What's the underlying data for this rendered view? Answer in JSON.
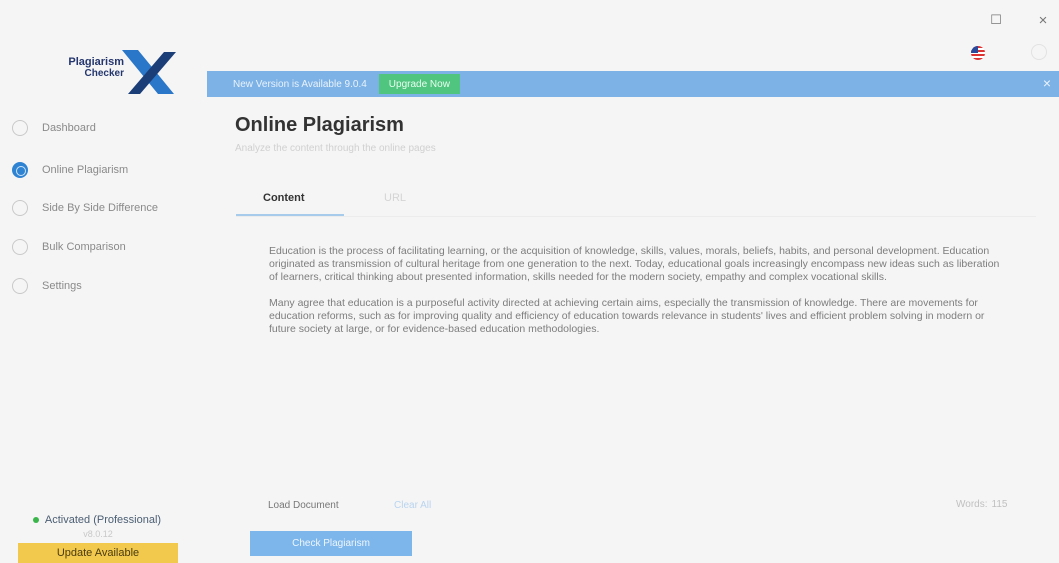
{
  "window": {
    "maximize_glyph": "☐",
    "close_glyph": "×"
  },
  "app": {
    "logo_line1": "Plagiarism",
    "logo_line2": "Checker",
    "logo_mark": "X"
  },
  "sidebar": {
    "items": [
      {
        "label": "Dashboard",
        "icon": "dashboard-icon",
        "active": false
      },
      {
        "label": "Online Plagiarism",
        "icon": "globe-icon",
        "active": true
      },
      {
        "label": "Side By Side Difference",
        "icon": "compare-icon",
        "active": false
      },
      {
        "label": "Bulk Comparison",
        "icon": "bulk-icon",
        "active": false
      },
      {
        "label": "Settings",
        "icon": "gear-icon",
        "active": false
      }
    ],
    "status": "Activated (Professional)",
    "version": "v8.0.12",
    "update_label": "Update Available"
  },
  "banner": {
    "text": "New Version is Available 9.0.4",
    "upgrade_label": "Upgrade Now",
    "close_glyph": "×"
  },
  "main": {
    "title": "Online Plagiarism",
    "subtitle": "Analyze the content through the online pages",
    "tabs": [
      {
        "label": "Content",
        "active": true
      },
      {
        "label": "URL",
        "active": false
      }
    ],
    "paragraphs": [
      "Education is the process of facilitating learning, or the acquisition of knowledge, skills, values, morals, beliefs, habits, and personal development. Education originated as transmission of cultural heritage from one generation to the next. Today, educational goals increasingly encompass new ideas such as liberation of learners, critical thinking about presented information, skills needed for the modern society, empathy and complex vocational skills.",
      "Many agree that education is a purposeful activity directed at achieving certain aims, especially the transmission of knowledge. There are movements for education reforms, such as for improving quality and efficiency of education towards relevance in students' lives and efficient problem solving in modern or future society at large, or for evidence-based education methodologies."
    ],
    "load_label": "Load Document",
    "clear_label": "Clear All",
    "words_label": "Words:",
    "words_value": "115",
    "check_label": "Check Plagiarism"
  },
  "colors": {
    "accent": "#2f83d3",
    "banner": "#7db2e6",
    "upgrade": "#4fc57f",
    "update": "#f2c94c",
    "status": "#39b54a"
  }
}
